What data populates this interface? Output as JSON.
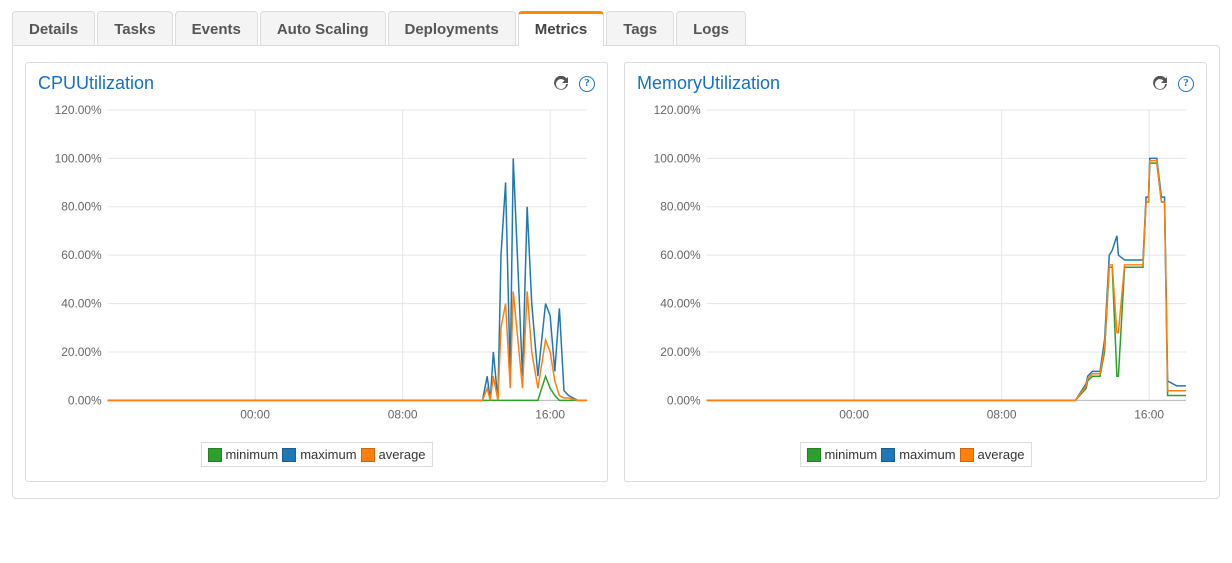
{
  "tabs": [
    {
      "label": "Details"
    },
    {
      "label": "Tasks"
    },
    {
      "label": "Events"
    },
    {
      "label": "Auto Scaling"
    },
    {
      "label": "Deployments"
    },
    {
      "label": "Metrics",
      "active": true
    },
    {
      "label": "Tags"
    },
    {
      "label": "Logs"
    }
  ],
  "legend": {
    "minimum": "minimum",
    "maximum": "maximum",
    "average": "average"
  },
  "colors": {
    "minimum": "#2ca02c",
    "maximum": "#1f77b4",
    "average": "#ff7f0e"
  },
  "charts": {
    "cpu": {
      "title": "CPUUtilization"
    },
    "memory": {
      "title": "MemoryUtilization"
    }
  },
  "chart_data": [
    {
      "id": "cpu",
      "type": "line",
      "title": "CPUUtilization",
      "xlabel": "",
      "ylabel": "",
      "x_ticks": [
        "00:00",
        "08:00",
        "16:00"
      ],
      "y_ticks": [
        "0.00%",
        "20.00%",
        "40.00%",
        "60.00%",
        "80.00%",
        "100.00%",
        "120.00%"
      ],
      "ylim": [
        0,
        120
      ],
      "x_range_minutes": [
        -480,
        1080
      ],
      "categories_minutes": [
        -480,
        -240,
        0,
        240,
        480,
        600,
        720,
        740,
        755,
        765,
        775,
        790,
        800,
        815,
        830,
        840,
        855,
        870,
        885,
        900,
        920,
        945,
        960,
        975,
        990,
        1005,
        1020,
        1050,
        1080
      ],
      "series": [
        {
          "name": "minimum",
          "values": [
            0,
            0,
            0,
            0,
            0,
            0,
            0,
            0,
            0,
            0,
            0,
            0,
            0,
            0,
            0,
            0,
            0,
            0,
            0,
            0,
            0,
            10,
            5,
            2,
            0,
            0,
            0,
            0,
            0
          ]
        },
        {
          "name": "average",
          "values": [
            0,
            0,
            0,
            0,
            0,
            0,
            0,
            0,
            5,
            0,
            10,
            0,
            30,
            40,
            5,
            45,
            25,
            5,
            45,
            20,
            5,
            25,
            20,
            8,
            2,
            1,
            1,
            0,
            0
          ]
        },
        {
          "name": "maximum",
          "values": [
            0,
            0,
            0,
            0,
            0,
            0,
            0,
            0,
            10,
            0,
            20,
            0,
            60,
            90,
            10,
            100,
            55,
            10,
            80,
            40,
            10,
            40,
            35,
            12,
            38,
            4,
            2,
            0,
            0
          ]
        }
      ]
    },
    {
      "id": "memory",
      "type": "line",
      "title": "MemoryUtilization",
      "xlabel": "",
      "ylabel": "",
      "x_ticks": [
        "00:00",
        "08:00",
        "16:00"
      ],
      "y_ticks": [
        "0.00%",
        "20.00%",
        "40.00%",
        "60.00%",
        "80.00%",
        "100.00%",
        "120.00%"
      ],
      "ylim": [
        0,
        120
      ],
      "x_range_minutes": [
        -480,
        1080
      ],
      "categories_minutes": [
        -480,
        -240,
        0,
        240,
        480,
        600,
        720,
        755,
        760,
        775,
        790,
        800,
        815,
        830,
        840,
        855,
        860,
        880,
        900,
        915,
        930,
        940,
        950,
        955,
        958,
        962,
        970,
        985,
        1000,
        1010,
        1020,
        1050,
        1080
      ],
      "series": [
        {
          "name": "minimum",
          "values": [
            0,
            0,
            0,
            0,
            0,
            0,
            0,
            5,
            8,
            10,
            10,
            10,
            20,
            55,
            55,
            10,
            10,
            55,
            55,
            55,
            55,
            55,
            82,
            82,
            82,
            98,
            98,
            98,
            82,
            82,
            2,
            2,
            2
          ]
        },
        {
          "name": "average",
          "values": [
            0,
            0,
            0,
            0,
            0,
            0,
            0,
            6,
            9,
            11,
            11,
            11,
            22,
            56,
            56,
            28,
            28,
            56,
            56,
            56,
            56,
            56,
            82,
            82,
            82,
            99,
            99,
            99,
            82,
            82,
            4,
            4,
            4
          ]
        },
        {
          "name": "maximum",
          "values": [
            0,
            0,
            0,
            0,
            0,
            0,
            0,
            7,
            10,
            12,
            12,
            12,
            25,
            60,
            62,
            68,
            60,
            58,
            58,
            58,
            58,
            58,
            84,
            84,
            84,
            100,
            100,
            100,
            84,
            84,
            8,
            6,
            6
          ]
        }
      ]
    }
  ]
}
